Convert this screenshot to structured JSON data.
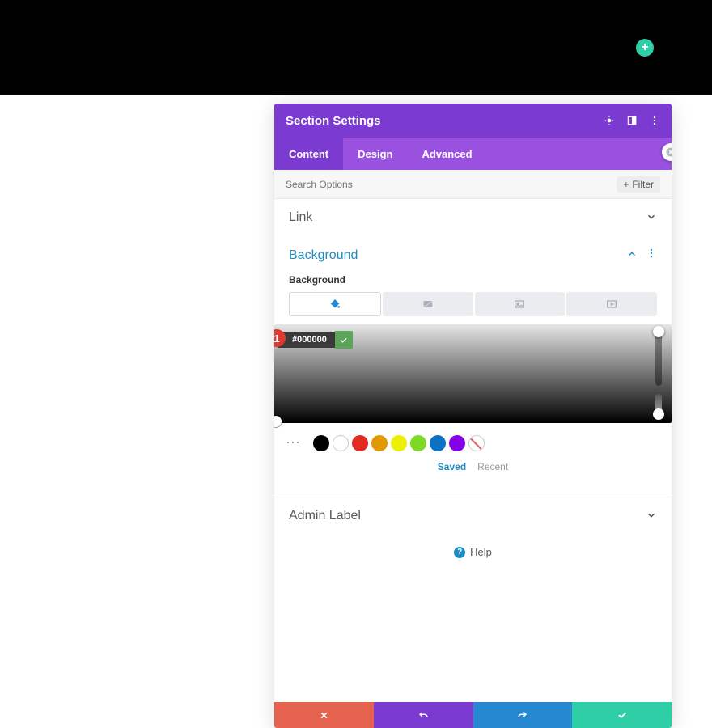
{
  "topbar": {
    "add_tooltip": "+"
  },
  "panel": {
    "title": "Section Settings",
    "tabs": {
      "content": "Content",
      "design": "Design",
      "advanced": "Advanced"
    },
    "search_placeholder": "Search Options",
    "filter_label": "Filter",
    "sections": {
      "link": "Link",
      "background": "Background",
      "background_sublabel": "Background",
      "admin_label": "Admin Label"
    },
    "color": {
      "hex": "#000000",
      "step_badge": "1"
    },
    "swatches": {
      "saved_label": "Saved",
      "recent_label": "Recent",
      "colors": [
        "#000000",
        "#ffffff",
        "#e02b20",
        "#e09900",
        "#edf000",
        "#7cda24",
        "#0c71c3",
        "#8300e9"
      ]
    },
    "help_label": "Help"
  }
}
